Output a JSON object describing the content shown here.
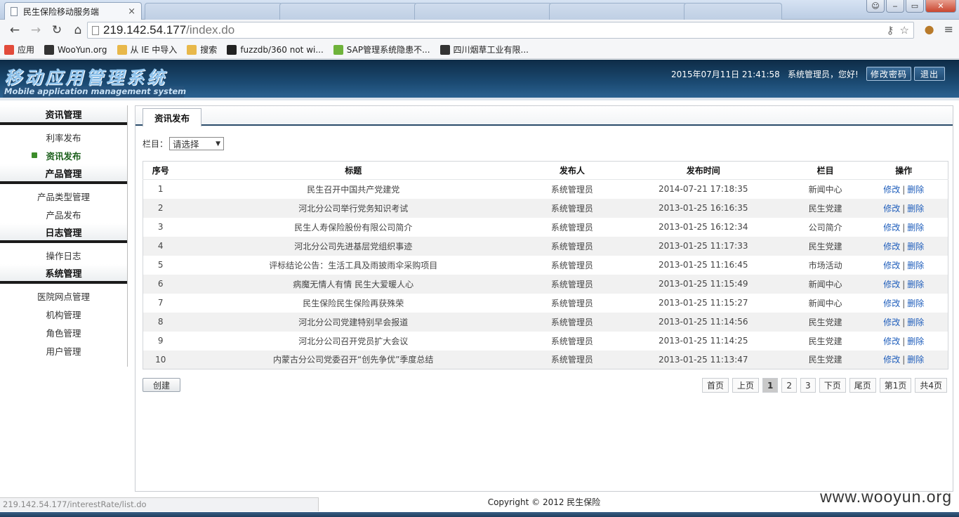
{
  "browser": {
    "tab_title": "民生保险移动服务端",
    "tab_close": "×",
    "window_buttons": [
      "‒",
      "▭",
      "✕"
    ],
    "url_host": "219.142.54.177",
    "url_path": "/index.do",
    "bookmarks": [
      {
        "label": "应用",
        "color": "#e24b3b"
      },
      {
        "label": "WooYun.org",
        "color": "#333333"
      },
      {
        "label": "从 IE 中导入",
        "color": "#e8b84a"
      },
      {
        "label": "搜索",
        "color": "#e8b84a"
      },
      {
        "label": "fuzzdb/360 not wi...",
        "color": "#222222"
      },
      {
        "label": "SAP管理系统隐患不...",
        "color": "#6fb33b"
      },
      {
        "label": "四川烟草工业有限...",
        "color": "#333333"
      }
    ]
  },
  "header": {
    "title_cn": "移动应用管理系统",
    "title_en": "Mobile application management system",
    "datetime": "2015年07月11日 21:41:58",
    "greeting": "系统管理员，您好!",
    "change_password": "修改密码",
    "logout": "退出"
  },
  "sidebar": {
    "groups": [
      {
        "title": "资讯管理",
        "items": [
          "利率发布",
          "资讯发布"
        ]
      },
      {
        "title": "产品管理",
        "items": [
          "产品类型管理",
          "产品发布"
        ]
      },
      {
        "title": "日志管理",
        "items": [
          "操作日志"
        ]
      },
      {
        "title": "系统管理",
        "items": [
          "医院网点管理",
          "机构管理",
          "角色管理",
          "用户管理"
        ]
      }
    ],
    "active_item": "资讯发布"
  },
  "main": {
    "tab_label": "资讯发布",
    "filter_label": "栏目：",
    "filter_value": "请选择",
    "columns": [
      "序号",
      "标题",
      "发布人",
      "发布时间",
      "栏目",
      "操作"
    ],
    "rows": [
      [
        "1",
        "民生召开中国共产党建党",
        "系统管理员",
        "2014-07-21 17:18:35",
        "新闻中心"
      ],
      [
        "2",
        "河北分公司举行党务知识考试",
        "系统管理员",
        "2013-01-25 16:16:35",
        "民生党建"
      ],
      [
        "3",
        "民生人寿保险股份有限公司简介",
        "系统管理员",
        "2013-01-25 16:12:34",
        "公司简介"
      ],
      [
        "4",
        "河北分公司先进基层党组织事迹",
        "系统管理员",
        "2013-01-25 11:17:33",
        "民生党建"
      ],
      [
        "5",
        "评标结论公告：生活工具及雨披雨伞采购项目",
        "系统管理员",
        "2013-01-25 11:16:45",
        "市场活动"
      ],
      [
        "6",
        "病魔无情人有情 民生大爱暖人心",
        "系统管理员",
        "2013-01-25 11:15:49",
        "新闻中心"
      ],
      [
        "7",
        "民生保险民生保险再获殊荣",
        "系统管理员",
        "2013-01-25 11:15:27",
        "新闻中心"
      ],
      [
        "8",
        "河北分公司党建特别早会报道",
        "系统管理员",
        "2013-01-25 11:14:56",
        "民生党建"
      ],
      [
        "9",
        "河北分公司召开党员扩大会议",
        "系统管理员",
        "2013-01-25 11:14:25",
        "民生党建"
      ],
      [
        "10",
        "内蒙古分公司党委召开“创先争优”季度总结",
        "系统管理员",
        "2013-01-25 11:13:47",
        "民生党建"
      ]
    ],
    "op_edit": "修改",
    "op_sep": "|",
    "op_delete": "删除",
    "create_button": "创建",
    "pager": [
      "首页",
      "上页",
      "1",
      "2",
      "3",
      "下页",
      "尾页",
      "第1页",
      "共4页"
    ],
    "current_page": "1"
  },
  "footer": {
    "copyright": "Copyright © 2012 民生保险",
    "status_url": "219.142.54.177/interestRate/list.do",
    "watermark": "www.wooyun.org"
  }
}
